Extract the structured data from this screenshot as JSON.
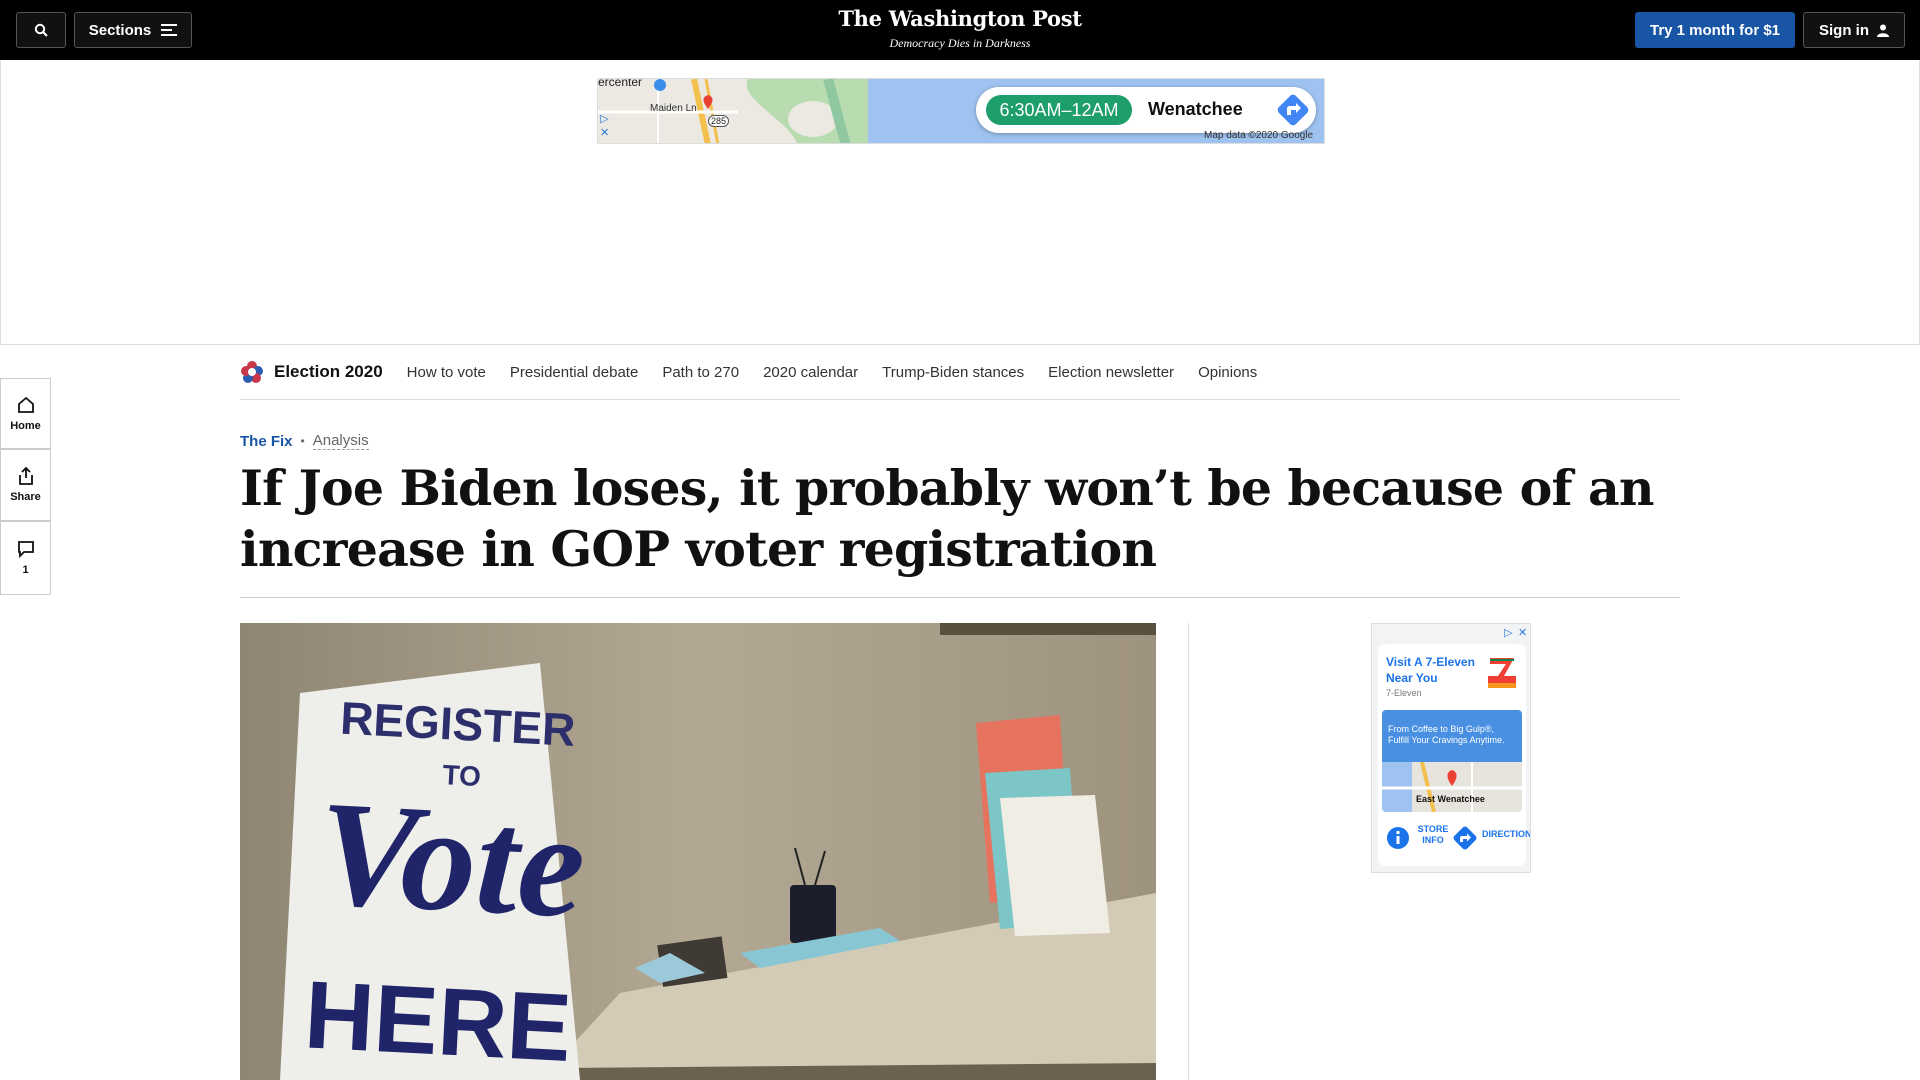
{
  "header": {
    "sections_label": "Sections",
    "brand_name": "The Washington Post",
    "brand_tagline": "Democracy Dies in Darkness",
    "subscribe_label": "Try 1 month for $1",
    "signin_label": "Sign in"
  },
  "top_ad": {
    "hours": "6:30AM–12AM",
    "city": "Wenatchee",
    "map_place": "ercenter",
    "street": "Maiden Ln",
    "route": "285",
    "attribution": "Map data ©2020 Google"
  },
  "rail": {
    "home_label": "Home",
    "share_label": "Share",
    "comments_count": "1"
  },
  "election_nav": {
    "title": "Election 2020",
    "links": [
      "How to vote",
      "Presidential debate",
      "Path to 270",
      "2020 calendar",
      "Trump-Biden stances",
      "Election newsletter",
      "Opinions"
    ]
  },
  "article": {
    "kicker_section": "The Fix",
    "kicker_type": "Analysis",
    "headline": "If Joe Biden loses, it probably won’t be because of an increase in GOP voter registration",
    "photo_sign_line1": "REGISTER",
    "photo_sign_line2": "TO",
    "photo_sign_line3": "Vote",
    "photo_sign_line4": "HERE"
  },
  "side_ad": {
    "title": "Visit A 7-Eleven Near You",
    "brand": "7-Eleven",
    "banner": "From Coffee to Big Gulp®, Fulfill Your Cravings Anytime.",
    "map_label": "East Wenatchee",
    "store_info": "STORE INFO",
    "directions": "DIRECTION"
  },
  "colors": {
    "brand_blue": "#1955a5",
    "ad_green": "#1e9e6a",
    "link_blue": "#1a73e8"
  }
}
